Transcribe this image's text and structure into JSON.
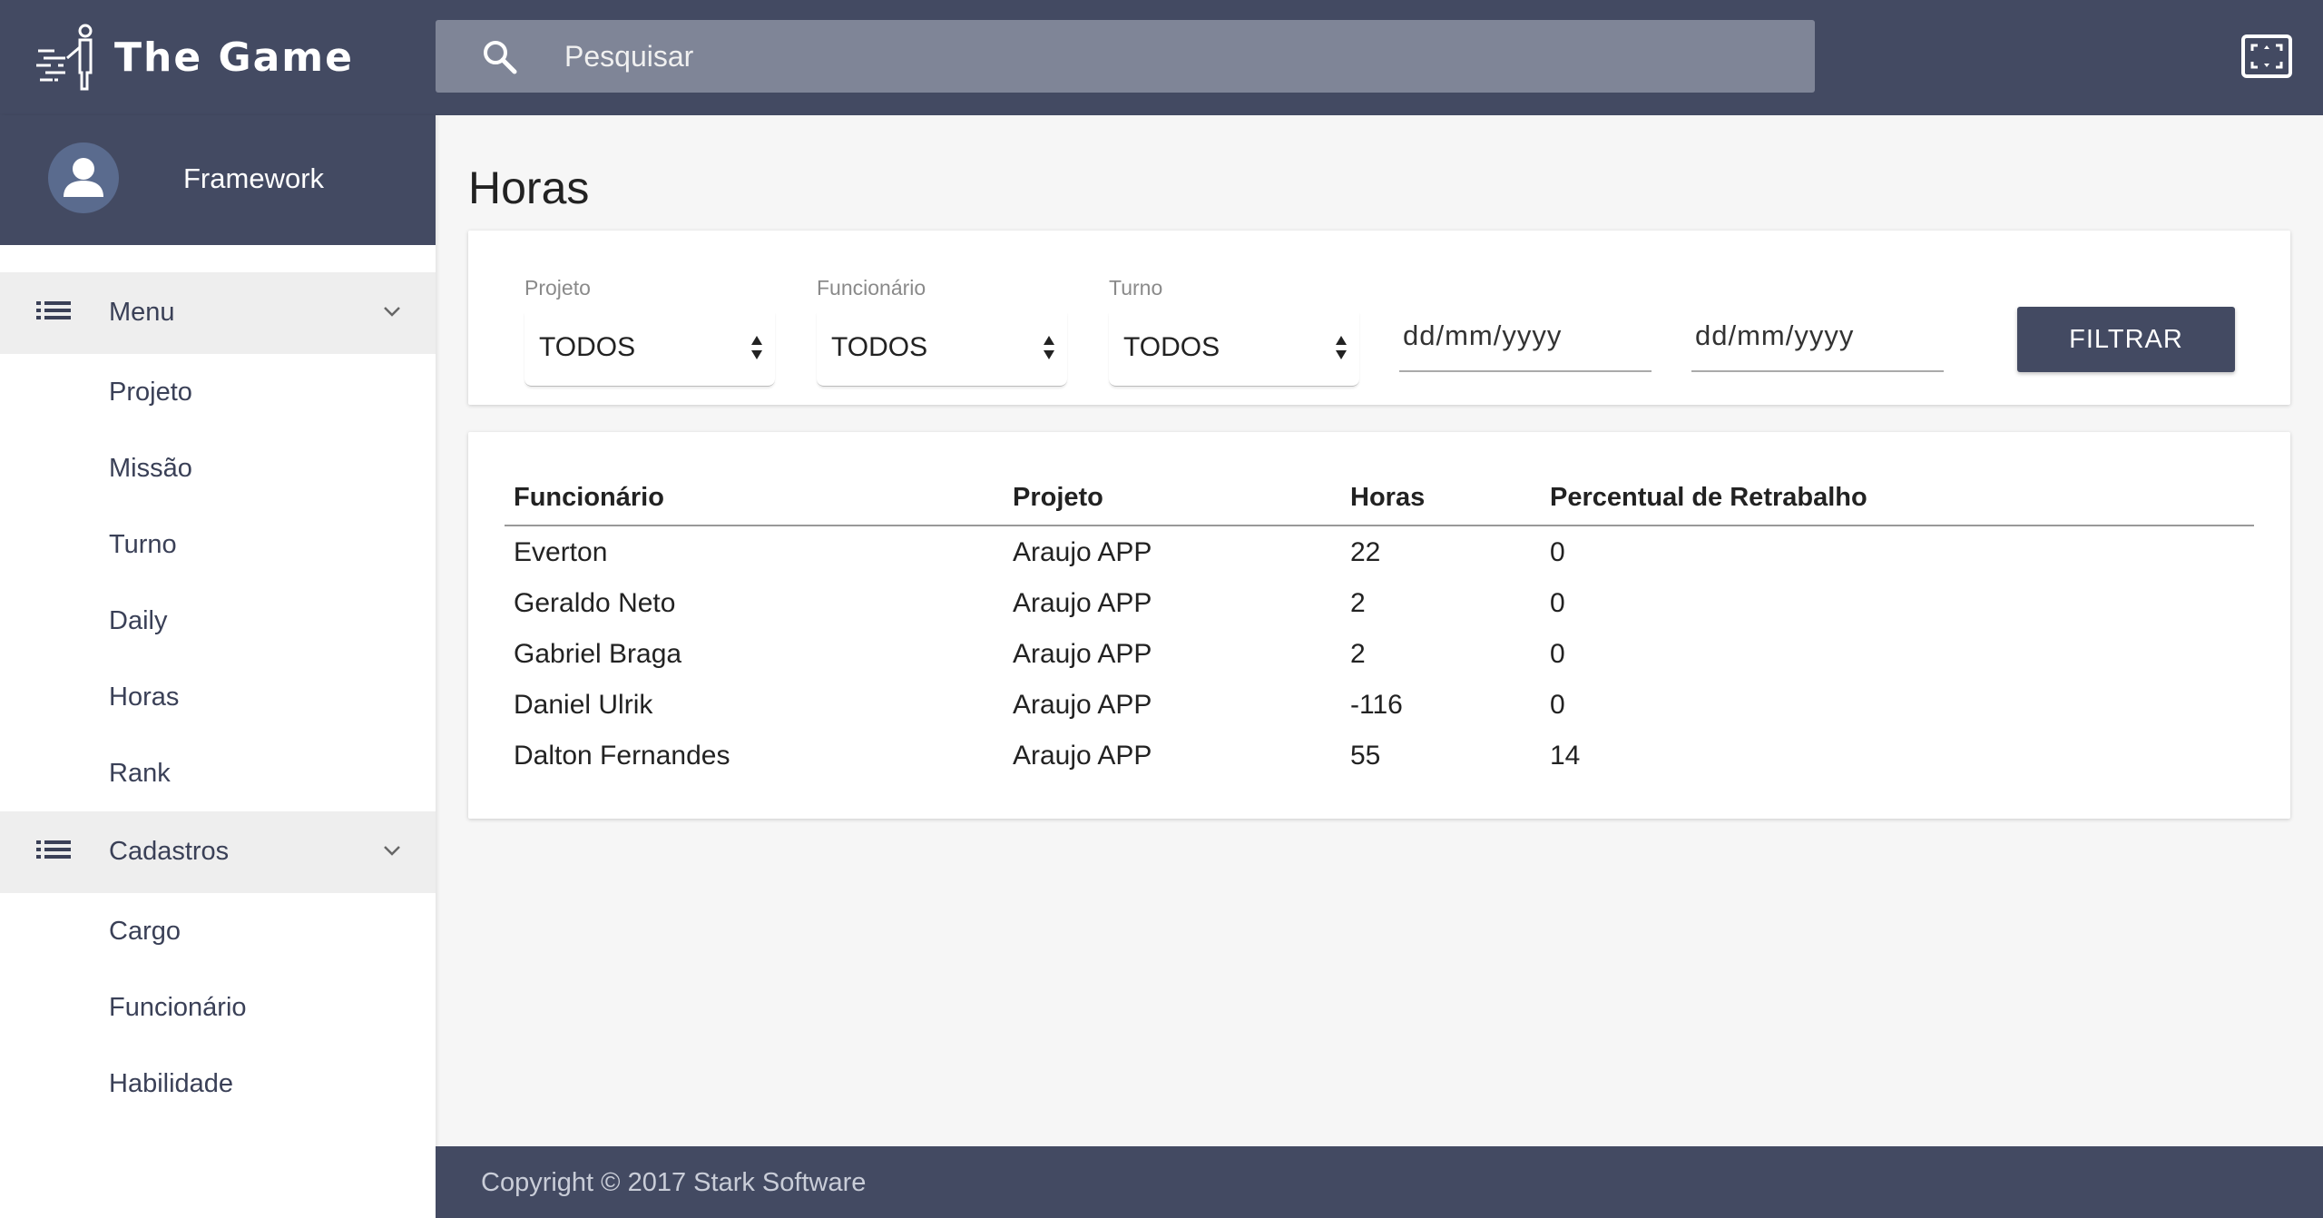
{
  "app": {
    "title": "The Game"
  },
  "search": {
    "placeholder": "Pesquisar",
    "value": ""
  },
  "user": {
    "name": "Framework"
  },
  "sidebar": {
    "groups": [
      {
        "label": "Menu",
        "items": [
          "Projeto",
          "Missão",
          "Turno",
          "Daily",
          "Horas",
          "Rank"
        ]
      },
      {
        "label": "Cadastros",
        "items": [
          "Cargo",
          "Funcionário",
          "Habilidade"
        ]
      }
    ]
  },
  "page": {
    "title": "Horas"
  },
  "filters": {
    "projeto": {
      "label": "Projeto",
      "value": "TODOS"
    },
    "funcionario": {
      "label": "Funcionário",
      "value": "TODOS"
    },
    "turno": {
      "label": "Turno",
      "value": "TODOS"
    },
    "date_start": {
      "placeholder": "dd/mm/yyyy"
    },
    "date_end": {
      "placeholder": "dd/mm/yyyy"
    },
    "button_label": "FILTRAR"
  },
  "table": {
    "columns": [
      "Funcionário",
      "Projeto",
      "Horas",
      "Percentual de Retrabalho"
    ],
    "rows": [
      [
        "Everton",
        "Araujo APP",
        "22",
        "0"
      ],
      [
        "Geraldo Neto",
        "Araujo APP",
        "2",
        "0"
      ],
      [
        "Gabriel Braga",
        "Araujo APP",
        "2",
        "0"
      ],
      [
        "Daniel Ulrik",
        "Araujo APP",
        "-116",
        "0"
      ],
      [
        "Dalton Fernandes",
        "Araujo APP",
        "55",
        "14"
      ]
    ]
  },
  "footer": {
    "text": "Copyright © 2017 Stark Software"
  },
  "colors": {
    "primary": "#434a62",
    "search_bg": "#7f8597",
    "page_bg": "#f6f6f6"
  }
}
